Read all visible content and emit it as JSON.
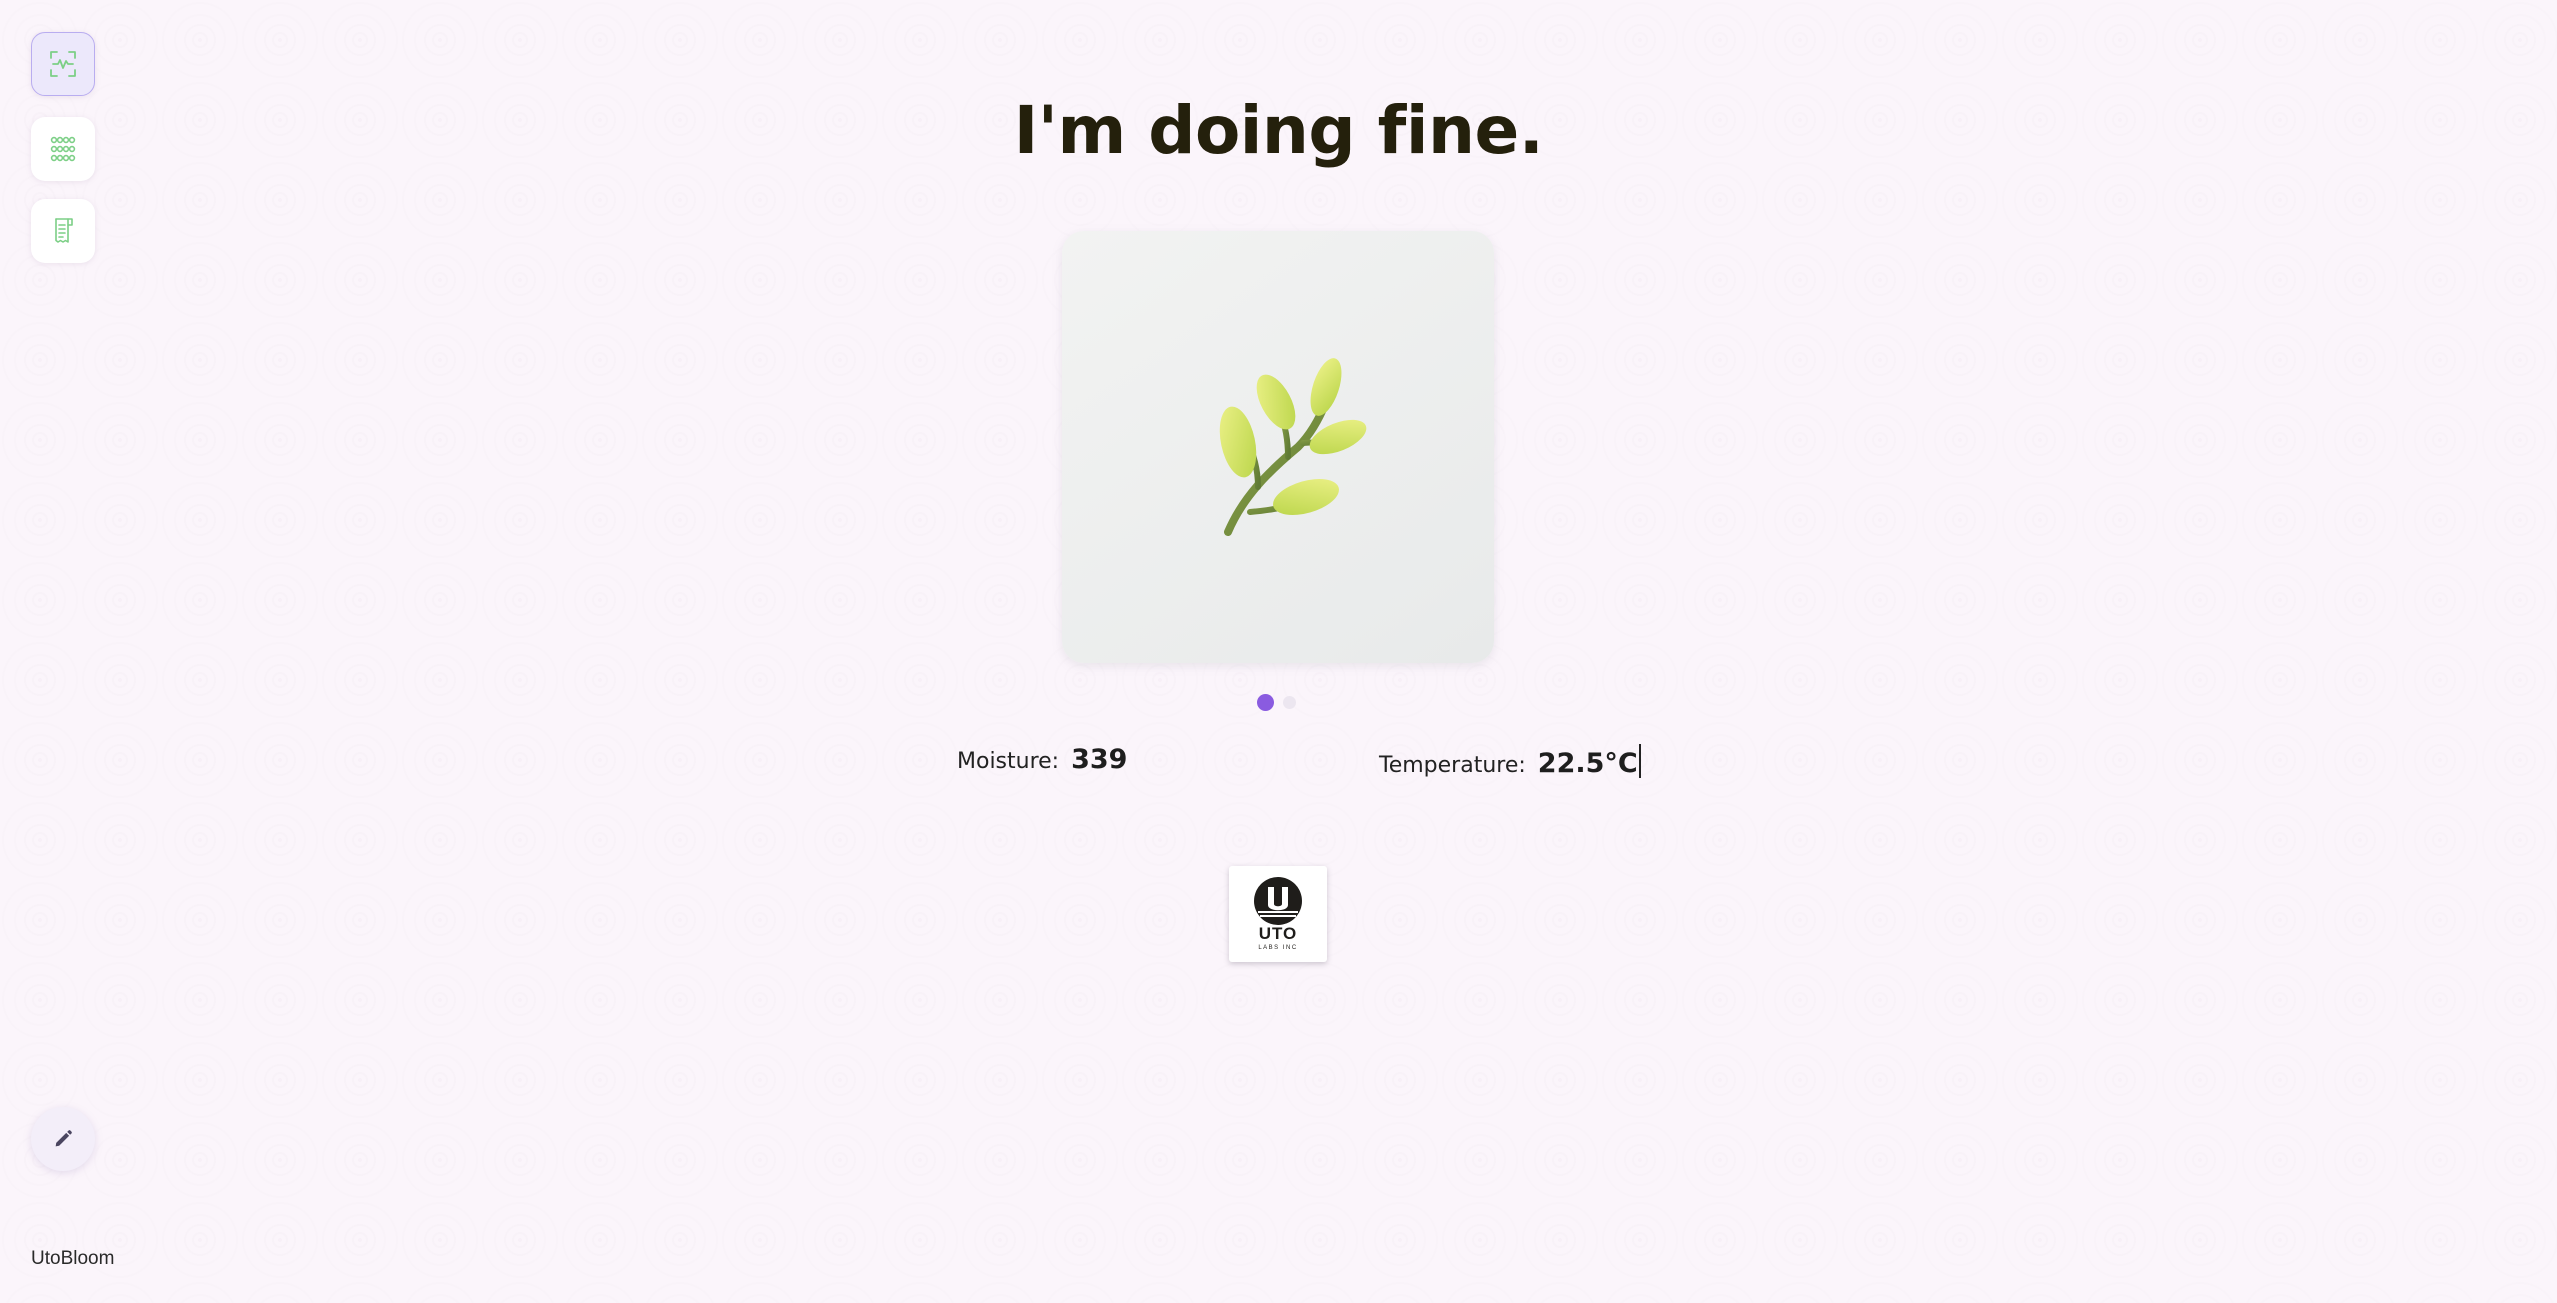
{
  "app": {
    "name": "UtoBloom"
  },
  "toolbar": {
    "items": [
      {
        "icon": "sensor-scan-icon",
        "active": true
      },
      {
        "icon": "grid-dots-icon",
        "active": false
      },
      {
        "icon": "receipt-icon",
        "active": false
      }
    ],
    "edit_icon": "pencil-icon"
  },
  "main": {
    "headline": "I'm doing fine.",
    "carousel": {
      "image_icon": "plant-sprig-icon",
      "slide_count": 2,
      "active_slide": 1
    },
    "readings": {
      "moisture_label": "Moisture:",
      "moisture_value": "339",
      "temperature_label": "Temperature:",
      "temperature_value": "22.5°C"
    },
    "logo": {
      "brand": "UTO",
      "tagline": "LABS INC"
    }
  },
  "colors": {
    "accent": "#8a5be0",
    "icon_green": "#7ccf86",
    "headline": "#24200c",
    "background": "#fbf5fb"
  }
}
